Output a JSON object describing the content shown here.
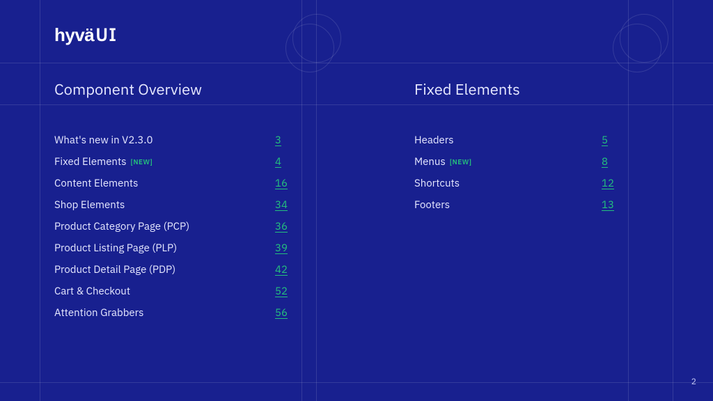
{
  "brand": {
    "name": "hyvä",
    "suffix": "UI"
  },
  "sections": {
    "left": {
      "title": "Component Overview",
      "items": [
        {
          "label": "What's new in V2.3.0",
          "page": "3",
          "new": false
        },
        {
          "label": "Fixed Elements",
          "page": "4",
          "new": true
        },
        {
          "label": "Content Elements",
          "page": "16",
          "new": false
        },
        {
          "label": "Shop Elements",
          "page": "34",
          "new": false
        },
        {
          "label": "Product Category Page (PCP)",
          "page": "36",
          "new": false
        },
        {
          "label": "Product Listing Page (PLP)",
          "page": "39",
          "new": false
        },
        {
          "label": "Product Detail Page (PDP)",
          "page": "42",
          "new": false
        },
        {
          "label": "Cart & Checkout",
          "page": "52",
          "new": false
        },
        {
          "label": "Attention Grabbers",
          "page": "56",
          "new": false
        }
      ]
    },
    "right": {
      "title": "Fixed Elements",
      "items": [
        {
          "label": "Headers",
          "page": "5",
          "new": false
        },
        {
          "label": "Menus",
          "page": "8",
          "new": true
        },
        {
          "label": "Shortcuts",
          "page": "12",
          "new": false
        },
        {
          "label": "Footers",
          "page": "13",
          "new": false
        }
      ]
    }
  },
  "badge_text": "[NEW]",
  "page_number": "2",
  "colors": {
    "background": "#18208f",
    "accent": "#24c07d",
    "text": "#e6e8ff"
  }
}
